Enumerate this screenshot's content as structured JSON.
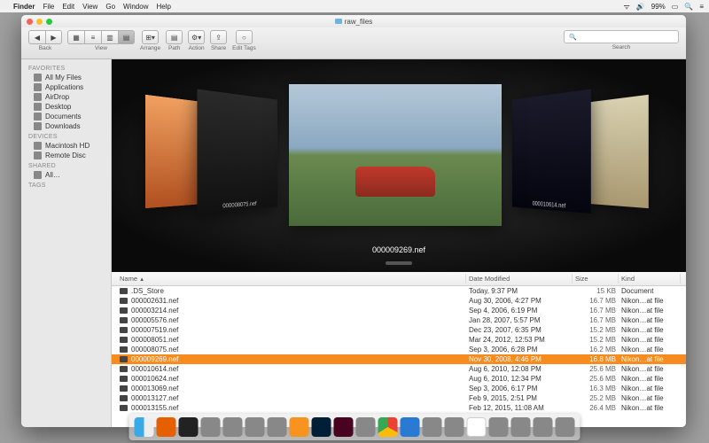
{
  "menubar": {
    "app": "Finder",
    "items": [
      "File",
      "Edit",
      "View",
      "Go",
      "Window",
      "Help"
    ],
    "right": {
      "battery": "99%",
      "wifi": "●",
      "vol": "◁",
      "search": "Q",
      "menu": "≡"
    }
  },
  "window": {
    "title": "raw_files",
    "toolbar": {
      "back": "Back",
      "view": "View",
      "arrange": "Arrange",
      "path": "Path",
      "action": "Action",
      "share": "Share",
      "edit_tags": "Edit Tags",
      "search": "Search",
      "search_placeholder": ""
    }
  },
  "sidebar": {
    "favorites_hdr": "FAVORITES",
    "favorites": [
      "All My Files",
      "Applications",
      "AirDrop",
      "Desktop",
      "Documents",
      "Downloads"
    ],
    "devices_hdr": "DEVICES",
    "devices": [
      "Macintosh HD",
      "Remote Disc"
    ],
    "shared_hdr": "SHARED",
    "shared": [
      "All…"
    ],
    "tags_hdr": "TAGS"
  },
  "coverflow": {
    "center_name": "000009269.nef",
    "left_label": "000008075.nef",
    "right_label": "000010614.nef"
  },
  "list": {
    "cols": {
      "name": "Name",
      "date": "Date Modified",
      "size": "Size",
      "kind": "Kind"
    },
    "rows": [
      {
        "name": ".DS_Store",
        "date": "Today, 9:37 PM",
        "size": "15 KB",
        "kind": "Document"
      },
      {
        "name": "000002631.nef",
        "date": "Aug 30, 2006, 4:27 PM",
        "size": "16.7 MB",
        "kind": "Nikon…at file"
      },
      {
        "name": "000003214.nef",
        "date": "Sep 4, 2006, 6:19 PM",
        "size": "16.7 MB",
        "kind": "Nikon…at file"
      },
      {
        "name": "000005576.nef",
        "date": "Jan 28, 2007, 5:57 PM",
        "size": "16.7 MB",
        "kind": "Nikon…at file"
      },
      {
        "name": "000007519.nef",
        "date": "Dec 23, 2007, 6:35 PM",
        "size": "15.2 MB",
        "kind": "Nikon…at file"
      },
      {
        "name": "000008051.nef",
        "date": "Mar 24, 2012, 12:53 PM",
        "size": "15.2 MB",
        "kind": "Nikon…at file"
      },
      {
        "name": "000008075.nef",
        "date": "Sep 3, 2006, 6:28 PM",
        "size": "16.2 MB",
        "kind": "Nikon…at file"
      },
      {
        "name": "000009269.nef",
        "date": "Nov 30, 2008, 4:46 PM",
        "size": "16.8 MB",
        "kind": "Nikon…at file",
        "selected": true
      },
      {
        "name": "000010614.nef",
        "date": "Aug 6, 2010, 12:08 PM",
        "size": "25.6 MB",
        "kind": "Nikon…at file"
      },
      {
        "name": "000010624.nef",
        "date": "Aug 6, 2010, 12:34 PM",
        "size": "25.6 MB",
        "kind": "Nikon…at file"
      },
      {
        "name": "000013069.nef",
        "date": "Sep 3, 2006, 6:17 PM",
        "size": "16.3 MB",
        "kind": "Nikon…at file"
      },
      {
        "name": "000013127.nef",
        "date": "Feb 9, 2015, 2:51 PM",
        "size": "25.2 MB",
        "kind": "Nikon…at file"
      },
      {
        "name": "000013155.nef",
        "date": "Feb 12, 2015, 11:08 AM",
        "size": "26.4 MB",
        "kind": "Nikon…at file"
      }
    ]
  },
  "dock": {
    "items": [
      "finder",
      "firefox",
      "mail",
      "terminal",
      "app1",
      "app2",
      "app3",
      "ai",
      "ps",
      "id",
      "app4",
      "chrome",
      "app5",
      "app6",
      "app7",
      "cal",
      "app8",
      "app9",
      "app10",
      "trash"
    ]
  }
}
